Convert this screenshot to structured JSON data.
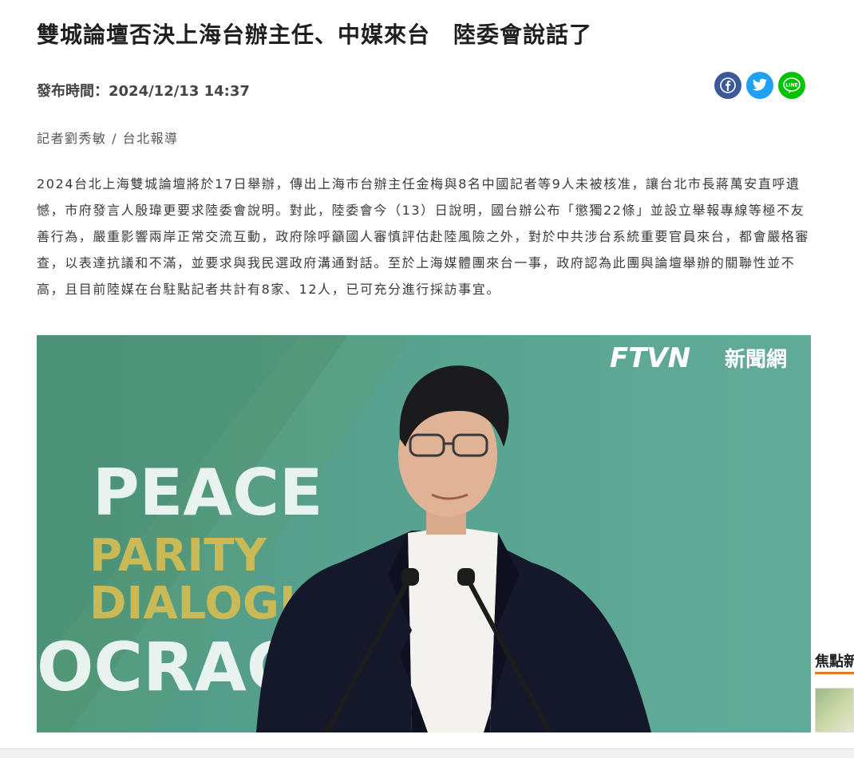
{
  "article": {
    "title": "雙城論壇否決上海台辦主任、中媒來台　陸委會說話了",
    "publish_label": "發布時間：",
    "publish_time": "2024/12/13 14:37",
    "byline": "記者劉秀敏 / 台北報導",
    "paragraphs": [
      "2024台北上海雙城論壇將於17日舉辦，傳出上海市台辦主任金梅與8名中國記者等9人未被核准，讓台北市長蔣萬安直呼遺憾，市府發言人殷瑋更要求陸委會說明。對此，陸委會今（13）日說明，國台辦公布「懲獨22條」並設立舉報專線等極不友善行為，嚴重影響兩岸正常交流互動，政府除呼籲國人審慎評估赴陸風險之外，對於中共涉台系統重要官員來台，都會嚴格審查，以表達抗議和不滿，並要求與我民選政府溝通對話。至於上海媒體團來台一事，政府認為此團與論壇舉辦的關聯性並不高，且目前陸媒在台駐點記者共計有8家、12人，已可充分進行採訪事宜。"
    ]
  },
  "share": {
    "buttons": [
      {
        "name": "facebook",
        "icon": "facebook-icon",
        "color": "#3b5998"
      },
      {
        "name": "twitter",
        "icon": "twitter-icon",
        "color": "#1da1f2"
      },
      {
        "name": "line",
        "icon": "line-icon",
        "color": "#00c300",
        "label": "LINE"
      }
    ]
  },
  "photo": {
    "logo_text": "FTVN",
    "logo_cn": "新聞網",
    "backdrop_words": [
      "PEACE",
      "PARITY",
      "DIALOGU",
      "OCRAC"
    ]
  },
  "sidebar": {
    "section_label": "焦點新",
    "accent_color": "#e87722"
  }
}
